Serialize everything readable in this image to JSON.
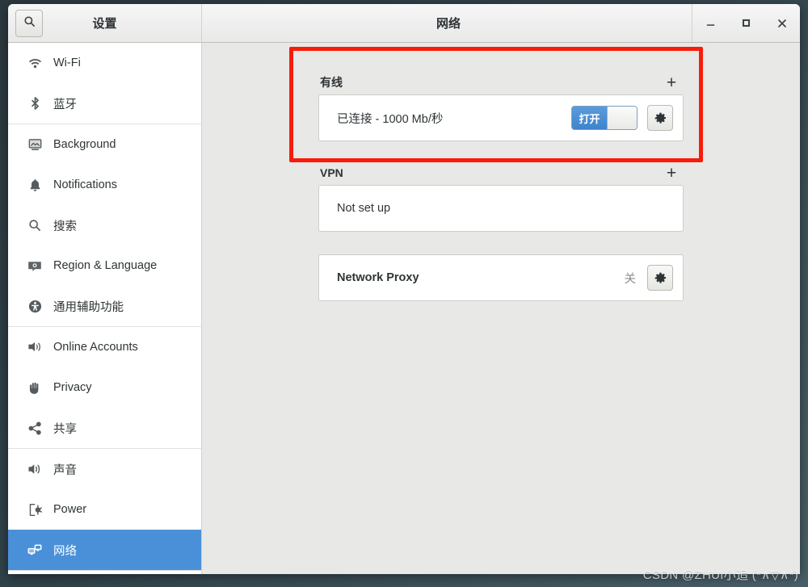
{
  "window": {
    "sidebar_title": "设置",
    "title": "网络",
    "controls": {
      "minimize": "−",
      "maximize": "□",
      "close": "✕"
    }
  },
  "search": {
    "icon": "search-icon"
  },
  "sidebar": {
    "groups": [
      {
        "items": [
          {
            "label": "Wi-Fi",
            "icon": "wifi-icon",
            "selected": false
          },
          {
            "label": "蓝牙",
            "icon": "bluetooth-icon",
            "selected": false
          }
        ]
      },
      {
        "items": [
          {
            "label": "Background",
            "icon": "background-icon",
            "selected": false
          },
          {
            "label": "Notifications",
            "icon": "bell-icon",
            "selected": false
          },
          {
            "label": "搜索",
            "icon": "search-icon",
            "selected": false
          },
          {
            "label": "Region & Language",
            "icon": "region-language-icon",
            "selected": false
          },
          {
            "label": "通用辅助功能",
            "icon": "accessibility-icon",
            "selected": false
          }
        ]
      },
      {
        "items": [
          {
            "label": "Online Accounts",
            "icon": "online-accounts-icon",
            "selected": false
          },
          {
            "label": "Privacy",
            "icon": "hand-privacy-icon",
            "selected": false
          },
          {
            "label": "共享",
            "icon": "share-icon",
            "selected": false
          }
        ]
      },
      {
        "items": [
          {
            "label": "声音",
            "icon": "speaker-icon",
            "selected": false
          },
          {
            "label": "Power",
            "icon": "power-plug-icon",
            "selected": false
          },
          {
            "label": "网络",
            "icon": "network-icon",
            "selected": true
          }
        ]
      }
    ]
  },
  "main": {
    "wired": {
      "title": "有线",
      "add_label": "+",
      "status": "已连接 - 1000 Mb/秒",
      "toggle_label": "打开",
      "toggle_on": true,
      "settings_icon": "gear-icon"
    },
    "vpn": {
      "title": "VPN",
      "add_label": "+",
      "status": "Not set up"
    },
    "proxy": {
      "title": "Network Proxy",
      "state": "关",
      "settings_icon": "gear-icon"
    }
  },
  "annotation": {
    "highlight_color": "#f81c0a"
  },
  "watermark": {
    "text": "CSDN @ZHUI小追 (*∧▽∧*)"
  }
}
